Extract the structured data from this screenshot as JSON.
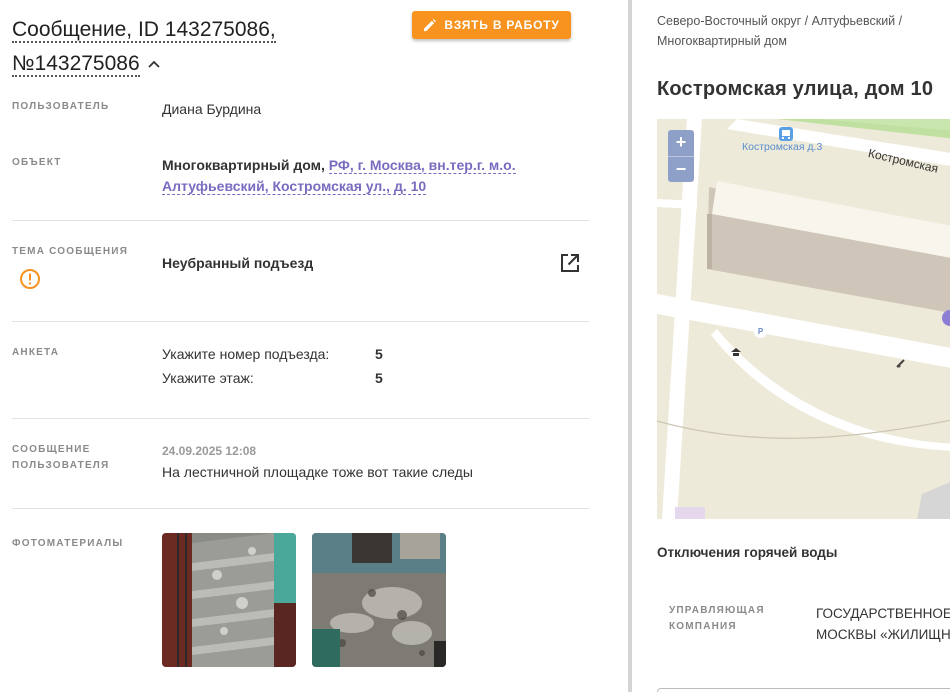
{
  "header": {
    "title_line1": "Сообщение, ID 143275086,",
    "title_line2": "№143275086",
    "take_button": "ВЗЯТЬ В РАБОТУ"
  },
  "user": {
    "label": "ПОЛЬЗОВАТЕЛЬ",
    "value": "Диана Бурдина"
  },
  "object": {
    "label": "ОБЪЕКТ",
    "type": "Многоквартирный дом,",
    "address_link": "РФ, г. Москва, вн.тер.г. м.о. Алтуфьевский, Костромская ул., д. 10"
  },
  "topic": {
    "label": "ТЕМА СООБЩЕНИЯ",
    "value": "Неубранный подъезд"
  },
  "survey": {
    "label": "АНКЕТА",
    "rows": [
      {
        "q": "Укажите номер подъезда:",
        "a": "5"
      },
      {
        "q": "Укажите этаж:",
        "a": "5"
      }
    ]
  },
  "message": {
    "label_line1": "СООБЩЕНИЕ",
    "label_line2": "ПОЛЬЗОВАТЕЛЯ",
    "date": "24.09.2025 12:08",
    "text": "На лестничной площадке тоже вот такие следы"
  },
  "photos": {
    "label": "ФОТОМАТЕРИАЛЫ"
  },
  "right": {
    "breadcrumbs_line1": "Северо-Восточный округ / Алтуфьевский /",
    "breadcrumbs_line2": "Многоквартирный дом",
    "address": "Костромская улица, дом 10",
    "map": {
      "zoom_in": "+",
      "zoom_out": "−",
      "stop_label": "Костромская д.3",
      "street_label": "Костромская",
      "parking_label": "P"
    },
    "hot_water": "Отключения горячей воды",
    "mgmt_label_line1": "УПРАВЛЯЮЩАЯ",
    "mgmt_label_line2": "КОМПАНИЯ",
    "mgmt_value_line1": "ГОСУДАРСТВЕННОЕ",
    "mgmt_value_line2": "МОСКВЫ «ЖИЛИЩН"
  },
  "colors": {
    "accent_orange": "#f7931e",
    "link_purple": "#7a6bc0",
    "warning_orange": "#f7931e"
  }
}
